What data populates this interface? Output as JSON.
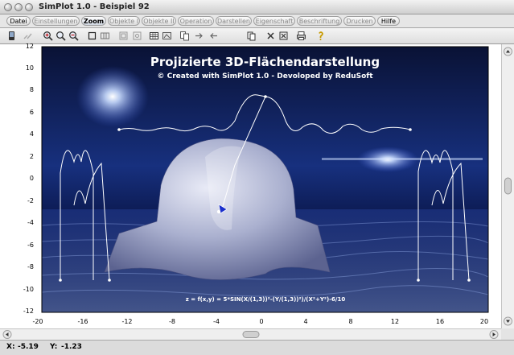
{
  "window": {
    "title": "SimPlot 1.0 - Beispiel 92"
  },
  "tabs": [
    {
      "label": "Datei",
      "enabled": true
    },
    {
      "label": "Einstellungen",
      "enabled": false
    },
    {
      "label": "Zoom",
      "enabled": true,
      "selected": true
    },
    {
      "label": "Objekte I",
      "enabled": false
    },
    {
      "label": "Objekte II",
      "enabled": false
    },
    {
      "label": "Operation",
      "enabled": false
    },
    {
      "label": "Darstellen",
      "enabled": false
    },
    {
      "label": "Eigenschaft",
      "enabled": false
    },
    {
      "label": "Beschriftung",
      "enabled": false
    },
    {
      "label": "Drucken",
      "enabled": false
    },
    {
      "label": "Hilfe",
      "enabled": true
    }
  ],
  "toolbar": {
    "icons": [
      "device-icon",
      "link-icon",
      "zoom-in-icon",
      "zoom-icon",
      "zoom-out-icon",
      "select-rect-icon",
      "grid-icon",
      "fit-icon",
      "fit-all-icon",
      "table-icon",
      "image-icon",
      "copy-icon",
      "arrow-right-icon",
      "arrow-left-icon",
      "pages-icon",
      "close-x-icon",
      "close-box-icon",
      "print-icon",
      "help-icon"
    ]
  },
  "chart_data": {
    "type": "surface",
    "title": "Projizierte 3D-Flächendarstellung",
    "subtitle": "© Created with SimPlot 1.0 - Devoloped by ReduSoft",
    "formula": "z = f(x,y) = 5*SIN(X/(1,3))²-(Y/(1,3))²)/(X²+Y²)-6/10",
    "xlim": [
      -20,
      20
    ],
    "ylim": [
      -12,
      12
    ],
    "xticks": [
      "-20",
      "-16",
      "-12",
      "-8",
      "-4",
      "0",
      "4",
      "8",
      "12",
      "16",
      "20"
    ],
    "yticks": [
      "12",
      "10",
      "8",
      "6",
      "4",
      "2",
      "0",
      "-2",
      "-4",
      "-6",
      "-8",
      "-10",
      "-12"
    ],
    "colors": {
      "background": "#0a1650",
      "surface": "#a9aecb",
      "curve": "#ffffff"
    }
  },
  "status": {
    "x_label": "X:",
    "x_value": "-5.19",
    "y_label": "Y:",
    "y_value": "-1.23"
  }
}
